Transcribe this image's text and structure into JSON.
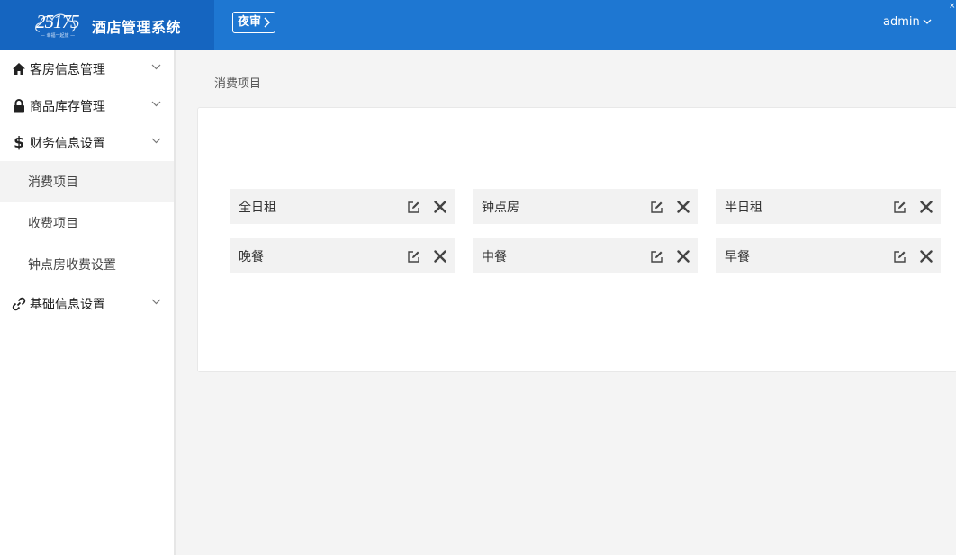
{
  "header": {
    "logo_number": "25175",
    "logo_slogan": "— 幸福一起旅 —",
    "system_title": "酒店管理系统",
    "night_audit_label": "夜审",
    "user_label": "admin",
    "corner_mark": "×"
  },
  "sidebar": {
    "groups": [
      {
        "label": "客房信息管理",
        "icon": "home-icon"
      },
      {
        "label": "商品库存管理",
        "icon": "lock-icon"
      },
      {
        "label": "财务信息设置",
        "icon": "dollar-icon"
      },
      {
        "label": "基础信息设置",
        "icon": "link-icon"
      }
    ],
    "finance_items": [
      {
        "label": "消费项目",
        "active": true
      },
      {
        "label": "收费项目",
        "active": false
      },
      {
        "label": "钟点房收费设置",
        "active": false
      }
    ]
  },
  "breadcrumb": "消费项目",
  "items": [
    {
      "label": "全日租"
    },
    {
      "label": "钟点房"
    },
    {
      "label": "半日租"
    },
    {
      "label": "晚餐"
    },
    {
      "label": "中餐"
    },
    {
      "label": "早餐"
    }
  ],
  "colors": {
    "header_bg": "#1e77d2",
    "logo_bg": "#1565c0",
    "active_bg": "#f3f3f3",
    "card_bg": "#f2f2f2"
  }
}
